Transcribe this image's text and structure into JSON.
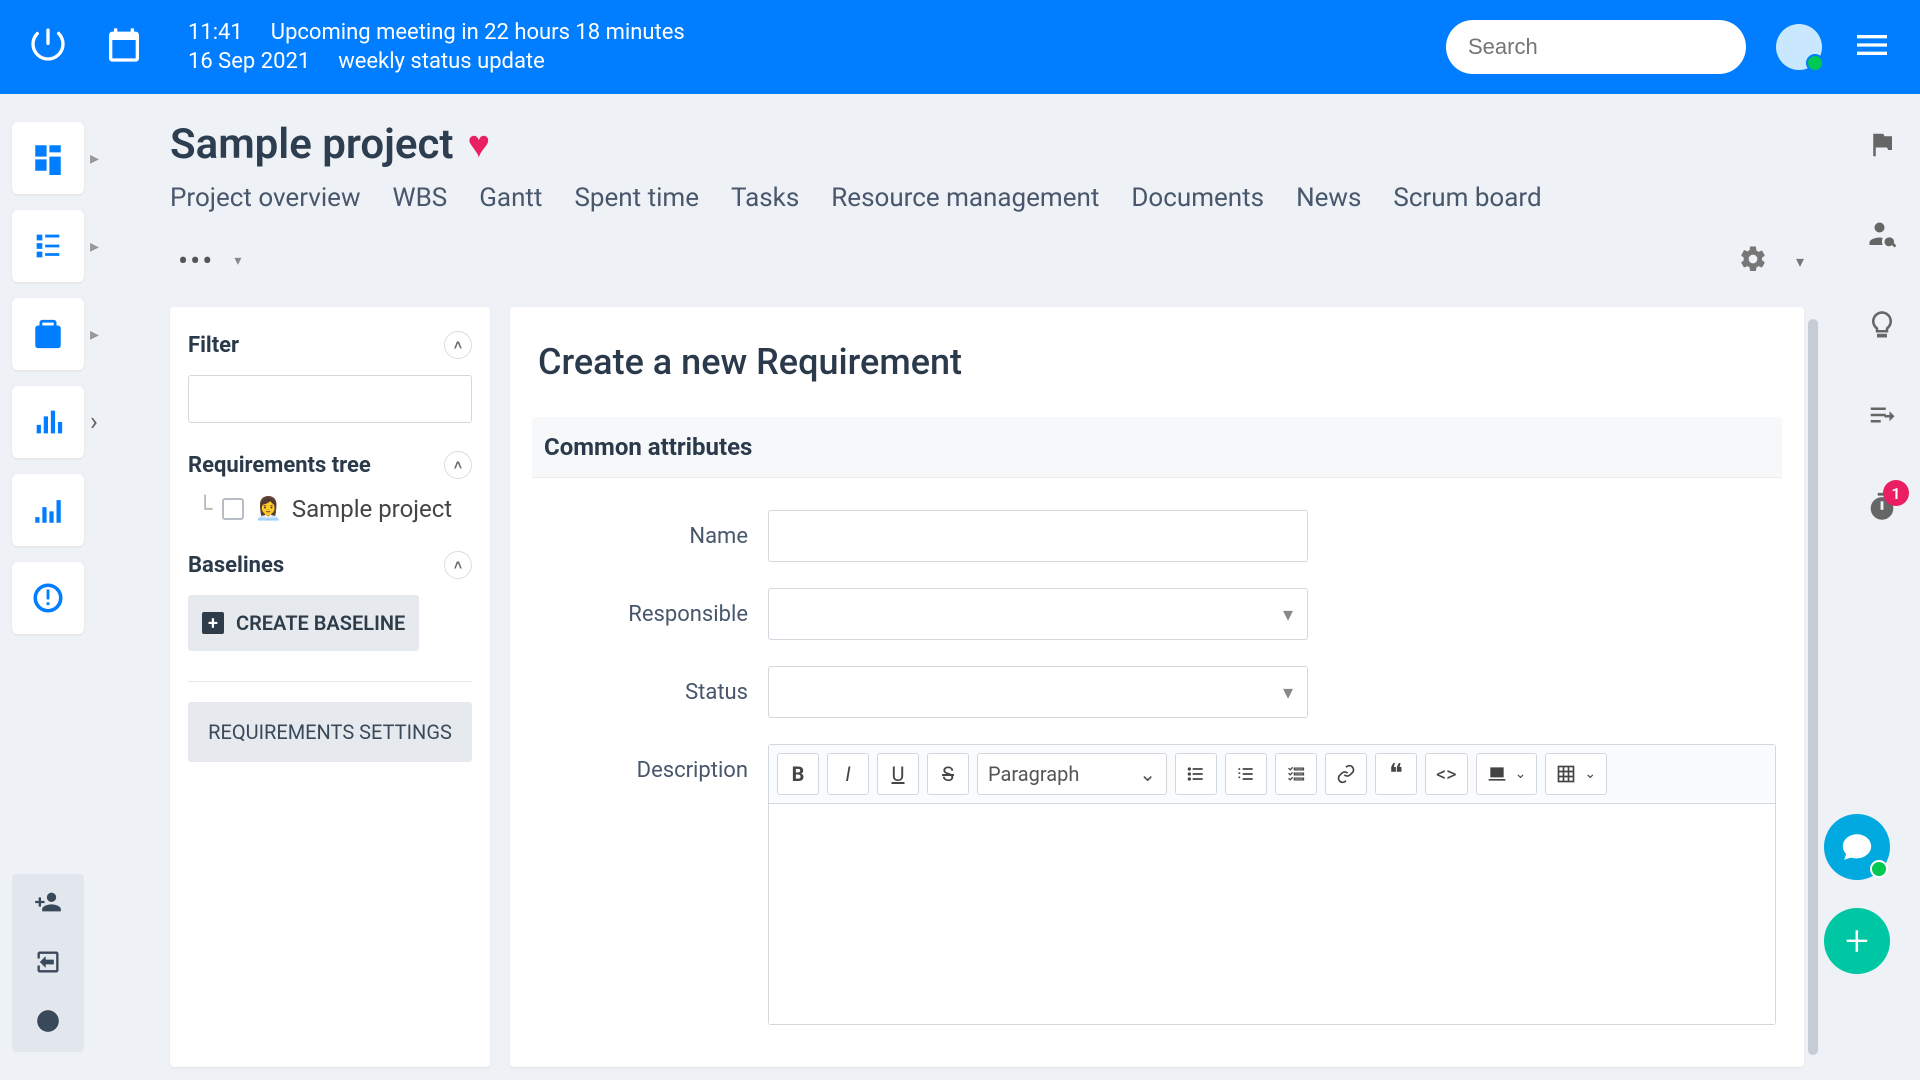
{
  "header": {
    "time": "11:41",
    "meeting_note": "Upcoming meeting in 22 hours 18 minutes",
    "date": "16 Sep 2021",
    "meeting_title": "weekly status update",
    "search_placeholder": "Search"
  },
  "project": {
    "title": "Sample project"
  },
  "tabs": {
    "overview": "Project overview",
    "wbs": "WBS",
    "gantt": "Gantt",
    "spent_time": "Spent time",
    "tasks": "Tasks",
    "resource": "Resource management",
    "documents": "Documents",
    "news": "News",
    "scrum": "Scrum board"
  },
  "sidebar": {
    "filter_title": "Filter",
    "tree_title": "Requirements tree",
    "tree_item": "Sample project",
    "baselines_title": "Baselines",
    "create_baseline": "CREATE BASELINE",
    "requirements_settings": "REQUIREMENTS SETTINGS"
  },
  "form": {
    "title": "Create a new Requirement",
    "section": "Common attributes",
    "name_label": "Name",
    "responsible_label": "Responsible",
    "status_label": "Status",
    "description_label": "Description",
    "paragraph_label": "Paragraph"
  },
  "notification": {
    "count": "1"
  }
}
